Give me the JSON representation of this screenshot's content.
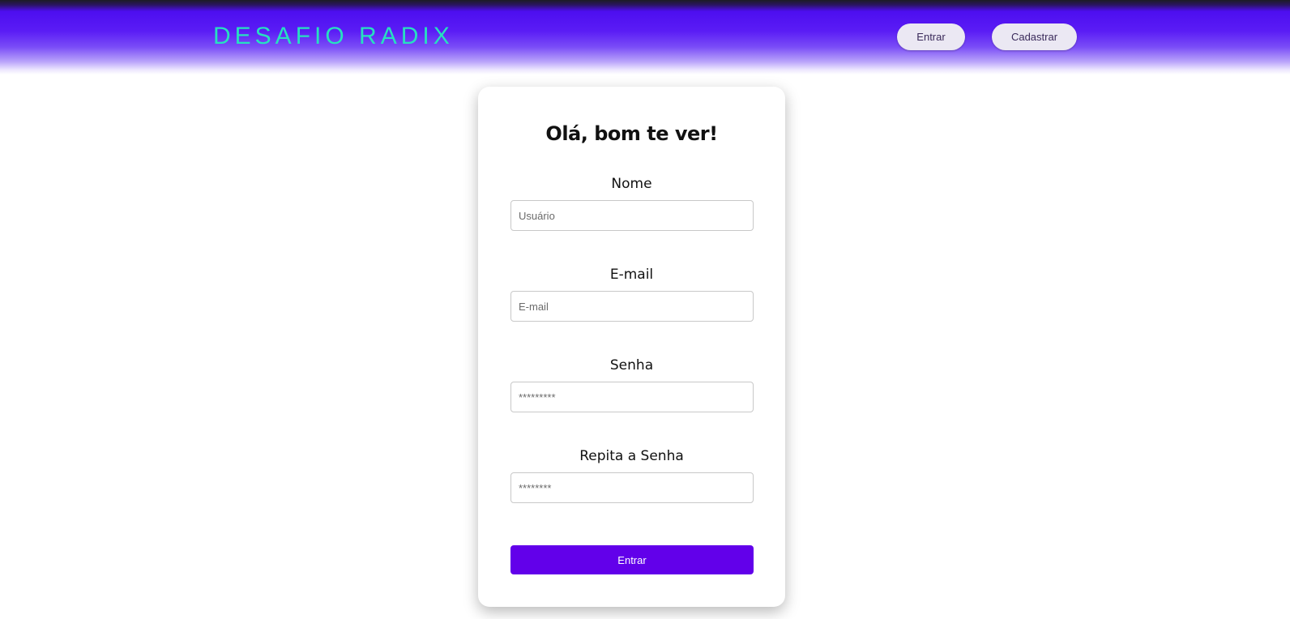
{
  "header": {
    "logo": "DESAFIO RADIX",
    "login_button": "Entrar",
    "signup_button": "Cadastrar"
  },
  "form": {
    "title": "Olá, bom te ver!",
    "name": {
      "label": "Nome",
      "placeholder": "Usuário"
    },
    "email": {
      "label": "E-mail",
      "placeholder": "E-mail"
    },
    "password": {
      "label": "Senha",
      "placeholder": "*********"
    },
    "confirm_password": {
      "label": "Repita a Senha",
      "placeholder": "********"
    },
    "submit_button": "Entrar"
  },
  "colors": {
    "logo": "#27e0c0",
    "header_accent": "#4d0ef0",
    "submit_button": "#6200ea"
  }
}
